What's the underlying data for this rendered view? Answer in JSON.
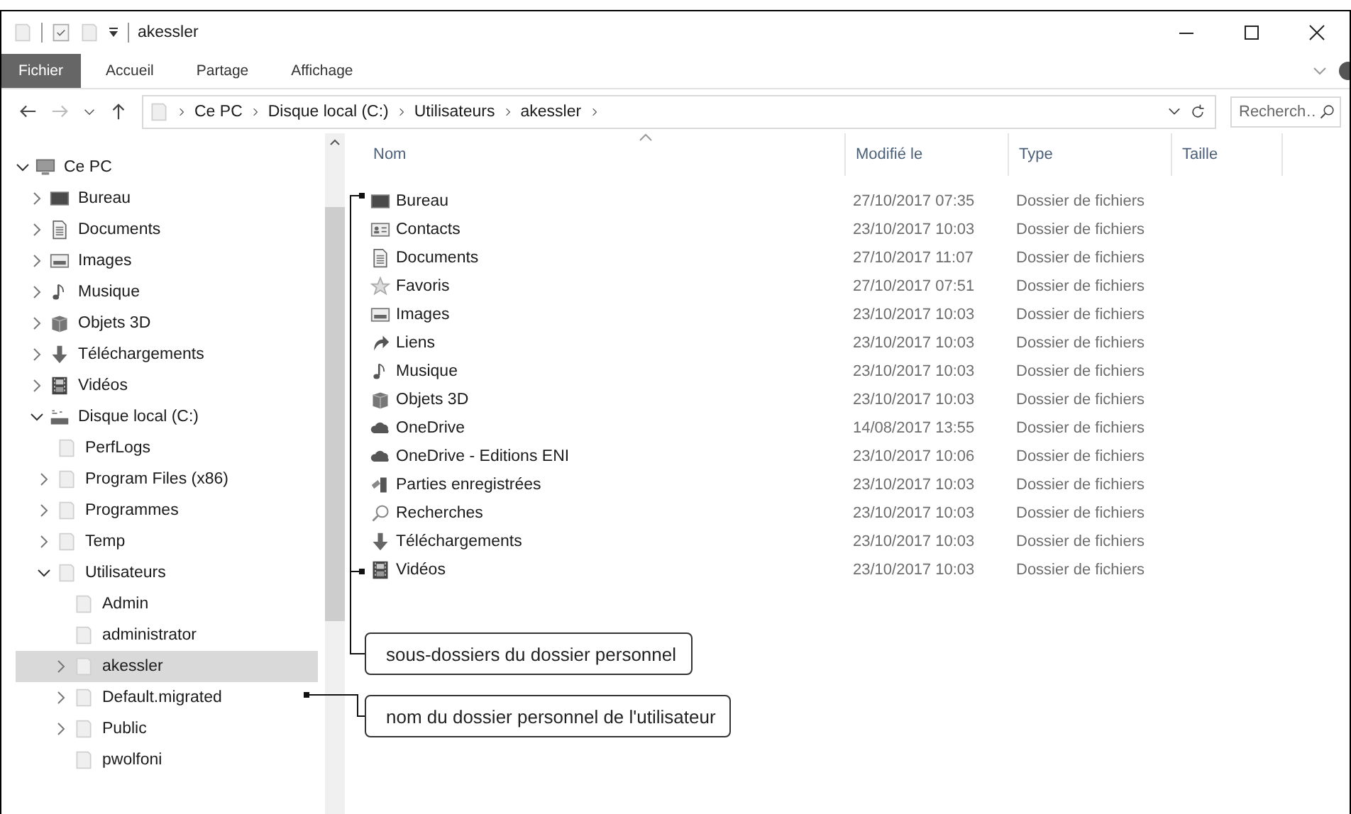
{
  "window": {
    "title": "akessler"
  },
  "ribbon_tabs": [
    {
      "label": "Fichier",
      "selected": true
    },
    {
      "label": "Accueil",
      "selected": false
    },
    {
      "label": "Partage",
      "selected": false
    },
    {
      "label": "Affichage",
      "selected": false
    }
  ],
  "address_bar": {
    "path": [
      "Ce PC",
      "Disque local (C:)",
      "Utilisateurs",
      "akessler"
    ]
  },
  "search": {
    "placeholder": "Recherch…"
  },
  "navigation_tree": [
    {
      "label": "Ce PC",
      "expandable": true,
      "expanded": true,
      "selected": false,
      "children": [
        {
          "label": "Bureau",
          "expandable": true,
          "expanded": false,
          "selected": false
        },
        {
          "label": "Documents",
          "expandable": true,
          "expanded": false,
          "selected": false
        },
        {
          "label": "Images",
          "expandable": true,
          "expanded": false,
          "selected": false
        },
        {
          "label": "Musique",
          "expandable": true,
          "expanded": false,
          "selected": false
        },
        {
          "label": "Objets 3D",
          "expandable": true,
          "expanded": false,
          "selected": false
        },
        {
          "label": "Téléchargements",
          "expandable": true,
          "expanded": false,
          "selected": false
        },
        {
          "label": "Vidéos",
          "expandable": true,
          "expanded": false,
          "selected": false
        },
        {
          "label": "Disque local (C:)",
          "expandable": true,
          "expanded": true,
          "selected": false,
          "children": [
            {
              "label": "PerfLogs",
              "expandable": false,
              "selected": false
            },
            {
              "label": "Program Files (x86)",
              "expandable": true,
              "expanded": false,
              "selected": false
            },
            {
              "label": "Programmes",
              "expandable": true,
              "expanded": false,
              "selected": false
            },
            {
              "label": "Temp",
              "expandable": true,
              "expanded": false,
              "selected": false
            },
            {
              "label": "Utilisateurs",
              "expandable": true,
              "expanded": true,
              "selected": false,
              "children": [
                {
                  "label": "Admin",
                  "expandable": false,
                  "selected": false
                },
                {
                  "label": "administrator",
                  "expandable": false,
                  "selected": false
                },
                {
                  "label": "akessler",
                  "expandable": true,
                  "expanded": false,
                  "selected": true
                },
                {
                  "label": "Default.migrated",
                  "expandable": true,
                  "expanded": false,
                  "selected": false
                },
                {
                  "label": "Public",
                  "expandable": true,
                  "expanded": false,
                  "selected": false
                },
                {
                  "label": "pwolfoni",
                  "expandable": false,
                  "selected": false
                }
              ]
            }
          ]
        }
      ]
    }
  ],
  "file_list": {
    "columns": [
      "Nom",
      "Modifié le",
      "Type",
      "Taille"
    ],
    "rows": [
      {
        "name": "Bureau",
        "modified": "27/10/2017 07:35",
        "type": "Dossier de fichiers"
      },
      {
        "name": "Contacts",
        "modified": "23/10/2017 10:03",
        "type": "Dossier de fichiers"
      },
      {
        "name": "Documents",
        "modified": "27/10/2017 11:07",
        "type": "Dossier de fichiers"
      },
      {
        "name": "Favoris",
        "modified": "27/10/2017 07:51",
        "type": "Dossier de fichiers"
      },
      {
        "name": "Images",
        "modified": "23/10/2017 10:03",
        "type": "Dossier de fichiers"
      },
      {
        "name": "Liens",
        "modified": "23/10/2017 10:03",
        "type": "Dossier de fichiers"
      },
      {
        "name": "Musique",
        "modified": "23/10/2017 10:03",
        "type": "Dossier de fichiers"
      },
      {
        "name": "Objets 3D",
        "modified": "23/10/2017 10:03",
        "type": "Dossier de fichiers"
      },
      {
        "name": "OneDrive",
        "modified": "14/08/2017 13:55",
        "type": "Dossier de fichiers"
      },
      {
        "name": "OneDrive - Editions ENI",
        "modified": "23/10/2017 10:06",
        "type": "Dossier de fichiers"
      },
      {
        "name": "Parties enregistrées",
        "modified": "23/10/2017 10:03",
        "type": "Dossier de fichiers"
      },
      {
        "name": "Recherches",
        "modified": "23/10/2017 10:03",
        "type": "Dossier de fichiers"
      },
      {
        "name": "Téléchargements",
        "modified": "23/10/2017 10:03",
        "type": "Dossier de fichiers"
      },
      {
        "name": "Vidéos",
        "modified": "23/10/2017 10:03",
        "type": "Dossier de fichiers"
      }
    ]
  },
  "callouts": [
    {
      "text": "sous-dossiers du dossier personnel"
    },
    {
      "text": "nom du dossier personnel de l'utilisateur"
    }
  ]
}
